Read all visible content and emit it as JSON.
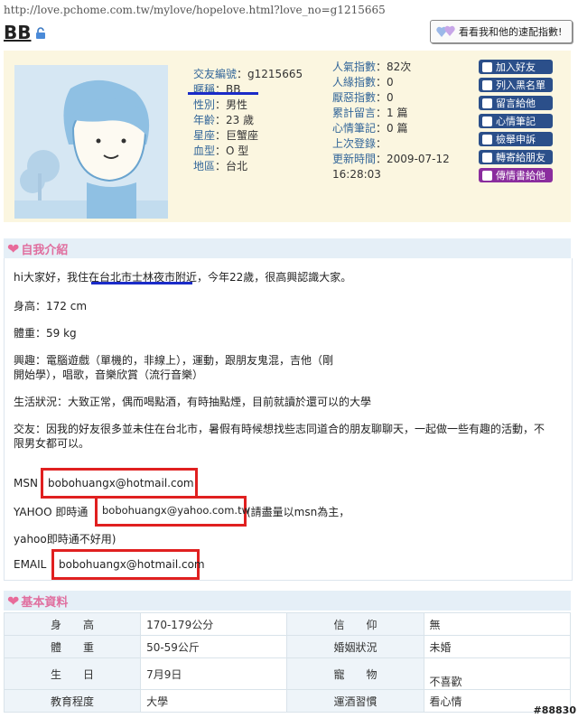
{
  "url": "http://love.pchome.com.tw/mylove/hopelove.html?love_no=g1215665",
  "profile_name": "BB",
  "speed_match_label": "看看我和他的速配指數!",
  "info": [
    {
      "label": "交友編號",
      "value": "g1215665"
    },
    {
      "label": "暱稱",
      "value": "BB"
    },
    {
      "label": "性別",
      "value": "男性"
    },
    {
      "label": "年齡",
      "value": "23 歲"
    },
    {
      "label": "星座",
      "value": "巨蟹座"
    },
    {
      "label": "血型",
      "value": "O 型"
    },
    {
      "label": "地區",
      "value": "台北"
    }
  ],
  "stats": [
    {
      "label": "人氣指數",
      "value": "82次"
    },
    {
      "label": "人緣指數",
      "value": "0"
    },
    {
      "label": "厭惡指數",
      "value": "0"
    },
    {
      "label": "累計留言",
      "value": "1 篇"
    },
    {
      "label": "心情筆記",
      "value": "0 篇"
    },
    {
      "label": "上次登錄",
      "value": ""
    },
    {
      "label": "更新時間",
      "value": "2009-07-12"
    },
    {
      "label": "",
      "value": "16:28:03"
    }
  ],
  "actions": [
    "加入好友",
    "列入黑名單",
    "留言給他",
    "心情筆記",
    "檢舉申訴",
    "轉寄給朋友",
    "傳情書給他"
  ],
  "intro": {
    "title": "自我介紹",
    "greeting": "hi大家好，我住在台北市士林夜市附近，今年22歲，很高興認識大家。",
    "height": "身高：172 cm",
    "weight": "體重：59 kg",
    "hobby1": "興趣：電腦遊戲（單機的，非線上），運動，跟朋友鬼混，吉他（剛",
    "hobby2": "開始學），唱歌，音樂欣賞（流行音樂）",
    "life": "生活狀況：大致正常，偶而喝點酒，有時抽點煙，目前就讀於還可以的大學",
    "friends1": "交友：因我的好友很多並未住在台北市，暑假有時候想找些志同道合的朋友聊聊天，一起做一些有趣的活動，不",
    "friends2": "限男女都可以。",
    "msn_label": "MSN",
    "msn": "bobohuangx@hotmail.com",
    "yahoo_label": "YAHOO 即時通",
    "yahoo": "bobohuangx@yahoo.com.tw",
    "yahoo_note": "(請盡量以msn為主，",
    "yahoo_note2": "yahoo即時通不好用)",
    "email_label": "EMAIL",
    "email": "bobohuangx@hotmail.com"
  },
  "basic": {
    "title": "基本資料",
    "rows": [
      [
        "身　　高",
        "170-179公分",
        "信　　仰",
        "無"
      ],
      [
        "體　　重",
        "50-59公斤",
        "婚姻狀況",
        "未婚"
      ],
      [
        "生　　日",
        "7月9日",
        "寵　　物",
        "不喜歡"
      ],
      [
        "教育程度",
        "大學",
        "運酒習慣",
        "看心情"
      ]
    ]
  },
  "watermark": "#88830",
  "colors": {
    "accent_pink": "#e06f9f",
    "action_blue": "#2b4f8a",
    "action_purple": "#8a2d9e",
    "highlight_red": "#e02020",
    "underline_blue": "#1a2bc8"
  }
}
